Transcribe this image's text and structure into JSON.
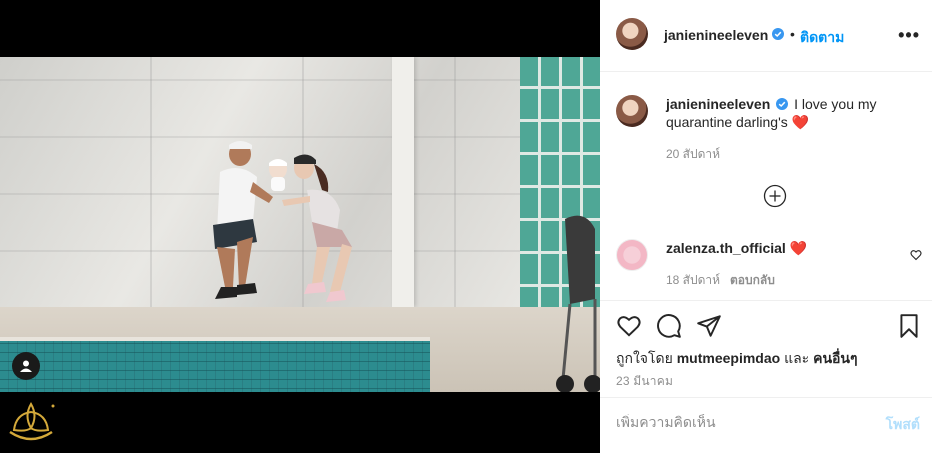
{
  "post": {
    "author": "janienineeleven",
    "follow_label": "ติดตาม",
    "separator": "•",
    "more_label": "•••",
    "caption": "I love you my quarantine darling's",
    "caption_emoji": "❤️",
    "caption_time": "20 สัปดาห์",
    "likes_prefix": "ถูกใจโดย",
    "likes_user": "mutmeepimdao",
    "likes_and": "และ",
    "likes_others": "คนอื่นๆ",
    "date": "23 มีนาคม"
  },
  "comments": [
    {
      "author": "zalenza.th_official",
      "text": "❤️",
      "time": "18 สัปดาห์",
      "reply_label": "ตอบกลับ"
    }
  ],
  "comment_box": {
    "placeholder": "เพิ่มความคิดเห็น",
    "post_label": "โพสต์"
  },
  "icons": {
    "verified": "verified-badge-icon",
    "like": "heart-icon",
    "comment": "comment-icon",
    "share": "paper-plane-icon",
    "save": "bookmark-icon",
    "load_more": "plus-circle-icon",
    "tag": "user-tag-icon"
  },
  "colors": {
    "accent": "#0095f6",
    "post_disabled": "#b2dffc",
    "secondary_text": "#8e8e8e",
    "heart_red": "#ed4956"
  }
}
